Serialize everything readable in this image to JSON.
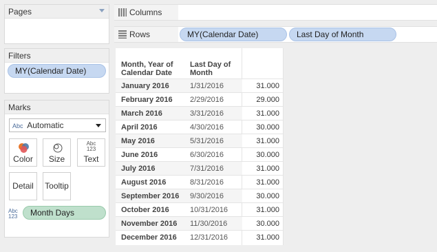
{
  "panels": {
    "pages": {
      "title": "Pages"
    },
    "filters": {
      "title": "Filters",
      "pill": "MY(Calendar Date)"
    },
    "marks": {
      "title": "Marks",
      "mark_type_icon": "Abc",
      "mark_type": "Automatic",
      "buttons": {
        "color": "Color",
        "size": "Size",
        "text": "Text",
        "detail": "Detail",
        "tooltip": "Tooltip"
      },
      "text_icon_top": "Abc",
      "text_icon_bottom": "123",
      "field_icon_top": "Abc",
      "field_icon_bottom": "123",
      "field_pill": "Month Days"
    }
  },
  "shelves": {
    "columns": {
      "label": "Columns"
    },
    "rows": {
      "label": "Rows",
      "pills": [
        "MY(Calendar Date)",
        "Last Day of Month"
      ]
    }
  },
  "table": {
    "headers": {
      "col1_line1": "Month, Year of",
      "col1_line2": "Calendar Date",
      "col2_line1": "Last Day of",
      "col2_line2": "Month"
    },
    "rows": [
      {
        "month": "January 2016",
        "last_day": "1/31/2016",
        "days": "31.000"
      },
      {
        "month": "February 2016",
        "last_day": "2/29/2016",
        "days": "29.000"
      },
      {
        "month": "March 2016",
        "last_day": "3/31/2016",
        "days": "31.000"
      },
      {
        "month": "April 2016",
        "last_day": "4/30/2016",
        "days": "30.000"
      },
      {
        "month": "May 2016",
        "last_day": "5/31/2016",
        "days": "31.000"
      },
      {
        "month": "June 2016",
        "last_day": "6/30/2016",
        "days": "30.000"
      },
      {
        "month": "July 2016",
        "last_day": "7/31/2016",
        "days": "31.000"
      },
      {
        "month": "August 2016",
        "last_day": "8/31/2016",
        "days": "31.000"
      },
      {
        "month": "September 2016",
        "last_day": "9/30/2016",
        "days": "30.000"
      },
      {
        "month": "October 2016",
        "last_day": "10/31/2016",
        "days": "31.000"
      },
      {
        "month": "November 2016",
        "last_day": "11/30/2016",
        "days": "30.000"
      },
      {
        "month": "December 2016",
        "last_day": "12/31/2016",
        "days": "31.000"
      }
    ]
  },
  "icons": {
    "columns": "columns-icon",
    "rows": "rows-icon",
    "dropdown": "chevron-down-icon"
  },
  "colors": {
    "pill_blue": "#c6d8f1",
    "pill_green": "#bfe0cc"
  }
}
